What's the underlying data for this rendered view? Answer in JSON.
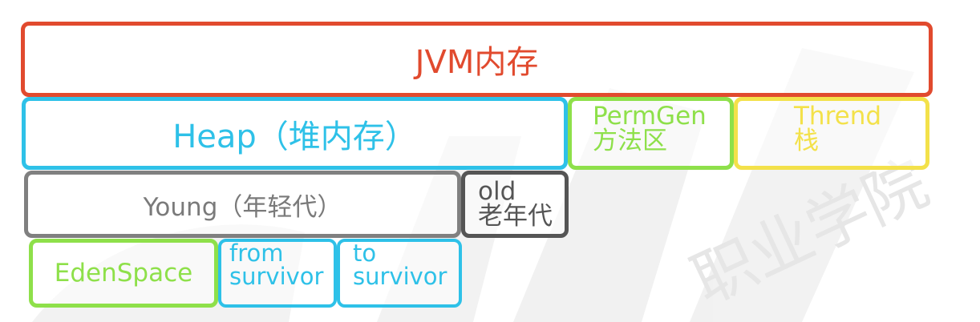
{
  "diagram": {
    "jvm": {
      "label": "JVM内存",
      "color": "#e14a2e"
    },
    "heap": {
      "label": "Heap（堆内存）",
      "color": "#2ec1e8"
    },
    "permgen": {
      "line1": "PermGen",
      "line2": "方法区",
      "color": "#8ee04a"
    },
    "thread": {
      "line1": "Thrend",
      "line2": "栈",
      "color": "#f3e14a"
    },
    "young": {
      "label": "Young（年轻代）",
      "color": "#808080"
    },
    "old": {
      "line1": "old",
      "line2": "老年代",
      "color": "#555555"
    },
    "eden": {
      "label": "EdenSpace",
      "color": "#8ee04a"
    },
    "from_survivor": {
      "line1": "from",
      "line2": "survivor",
      "color": "#2ec1e8"
    },
    "to_survivor": {
      "line1": "to",
      "line2": "survivor",
      "color": "#2ec1e8"
    }
  },
  "watermark": {
    "text": "职业学院"
  }
}
